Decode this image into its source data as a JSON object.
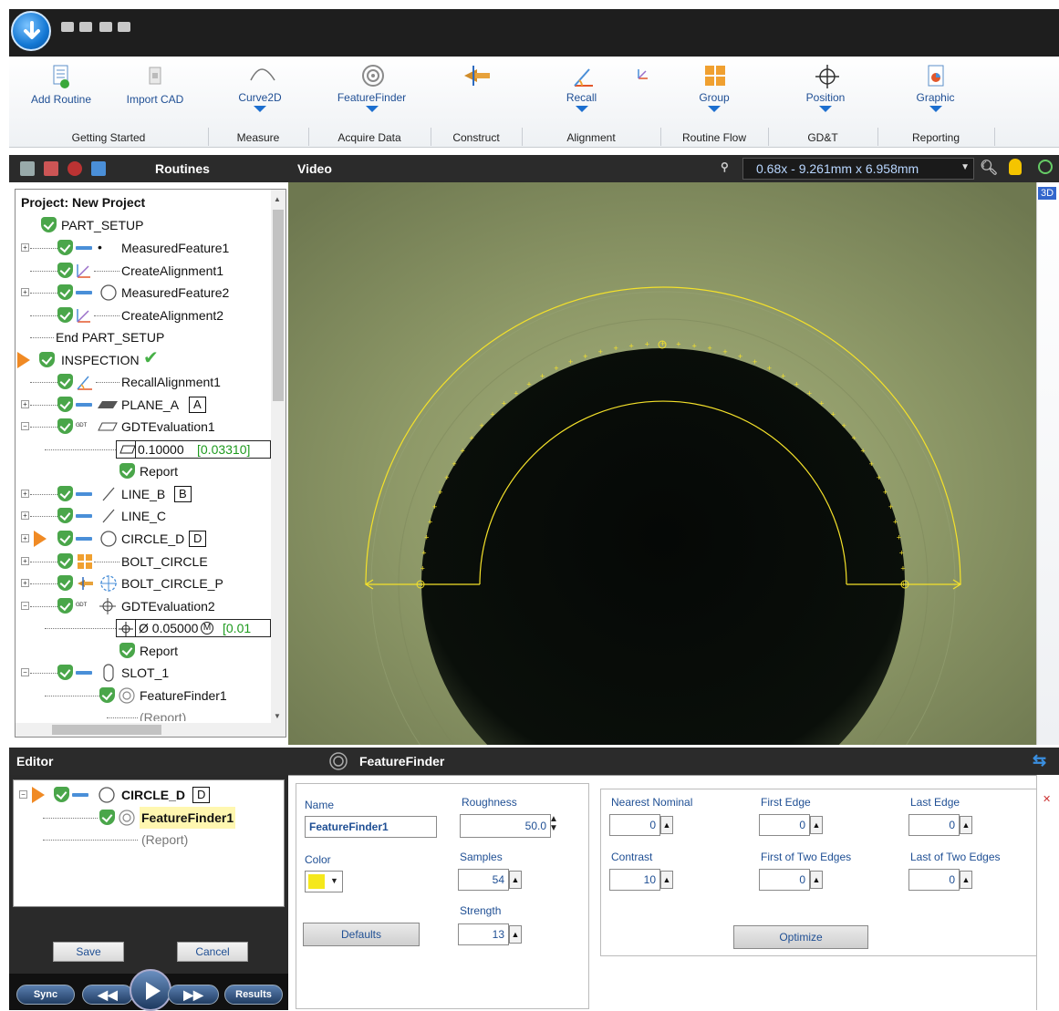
{
  "ribbon": {
    "buttons": {
      "add_routine": "Add Routine",
      "import_cad": "Import CAD",
      "curve2d": "Curve2D",
      "featurefinder": "FeatureFinder",
      "recall": "Recall",
      "group": "Group",
      "position": "Position",
      "graphic": "Graphic"
    },
    "groups": [
      "Getting Started",
      "Measure",
      "Acquire Data",
      "Construct",
      "Alignment",
      "Routine Flow",
      "GD&T",
      "Reporting"
    ]
  },
  "routines_panel": {
    "title": "Routines"
  },
  "video_panel": {
    "title": "Video",
    "zoom_readout": "0.68x - 9.261mm x 6.958mm",
    "view_label": "3D"
  },
  "tree": {
    "project": "Project: New Project",
    "part_setup": "PART_SETUP",
    "measured_feature_1": "MeasuredFeature1",
    "create_alignment_1": "CreateAlignment1",
    "measured_feature_2": "MeasuredFeature2",
    "create_alignment_2": "CreateAlignment2",
    "end_part_setup": "End PART_SETUP",
    "inspection": "INSPECTION",
    "recall_alignment_1": "RecallAlignment1",
    "plane_a": "PLANE_A",
    "plane_a_datum": "A",
    "gdt_eval_1": "GDTEvaluation1",
    "gdt_eval_1_value": "0.10000",
    "gdt_eval_1_result": "[0.03310]",
    "report_1": "Report",
    "line_b": "LINE_B",
    "line_b_datum": "B",
    "line_c": "LINE_C",
    "circle_d": "CIRCLE_D",
    "circle_d_datum": "D",
    "bolt_circle": "BOLT_CIRCLE",
    "bolt_circle_p": "BOLT_CIRCLE_P",
    "gdt_eval_2": "GDTEvaluation2",
    "gdt_eval_2_value": "Ø 0.05000",
    "gdt_eval_2_mod": "M",
    "gdt_eval_2_result": "[0.01",
    "report_2": "Report",
    "slot_1": "SLOT_1",
    "feature_finder_1": "FeatureFinder1",
    "report_3": "(Report)"
  },
  "editor": {
    "title": "Editor",
    "circle_d": "CIRCLE_D",
    "circle_d_datum": "D",
    "feature_finder": "FeatureFinder1",
    "report": "(Report)",
    "save": "Save",
    "cancel": "Cancel"
  },
  "transport": {
    "sync": "Sync",
    "results": "Results"
  },
  "featurefinder_panel": {
    "title": "FeatureFinder",
    "name_label": "Name",
    "name_value": "FeatureFinder1",
    "color_label": "Color",
    "color_value": "#f5e81c",
    "defaults": "Defaults",
    "roughness_label": "Roughness",
    "roughness_value": "50.0",
    "samples_label": "Samples",
    "samples_value": "54",
    "strength_label": "Strength",
    "strength_value": "13",
    "nearest_nominal_label": "Nearest Nominal",
    "nearest_nominal_value": "0",
    "first_edge_label": "First Edge",
    "first_edge_value": "0",
    "last_edge_label": "Last Edge",
    "last_edge_value": "0",
    "contrast_label": "Contrast",
    "contrast_value": "10",
    "first_two_label": "First of Two Edges",
    "first_two_value": "0",
    "last_two_label": "Last of Two Edges",
    "last_two_value": "0",
    "optimize": "Optimize"
  }
}
